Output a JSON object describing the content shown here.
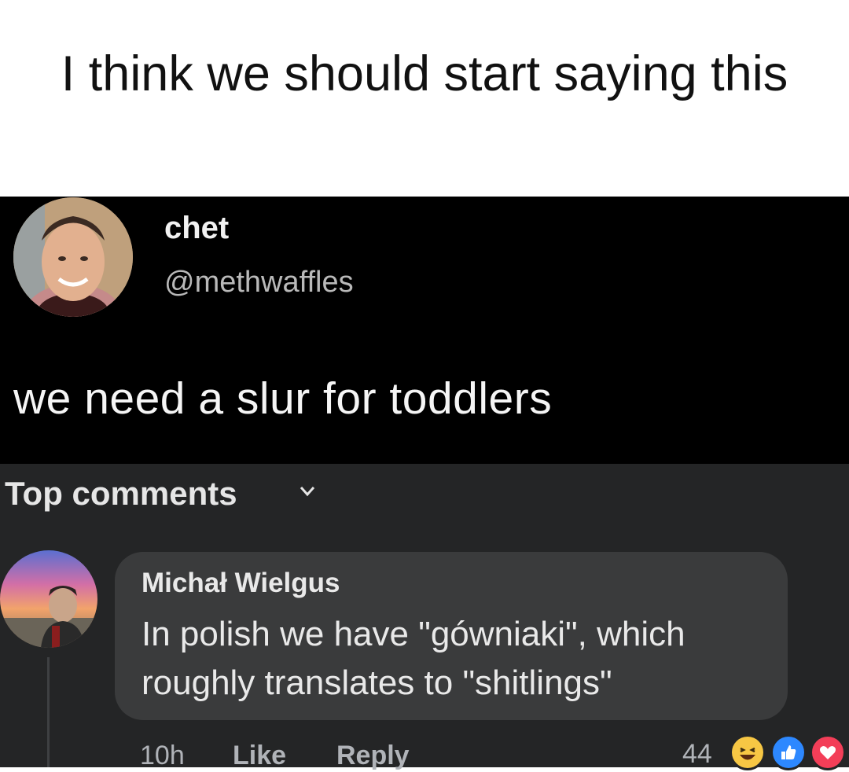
{
  "caption": {
    "text": "I think we should start saying this"
  },
  "tweet": {
    "author_name": "chet",
    "author_handle": "@methwaffles",
    "body": "we need a slur for toddlers"
  },
  "comments_section": {
    "sort_label": "Top comments",
    "comment": {
      "author": "Michał Wielgus",
      "text": "In polish we have \"gówniaki\", which roughly translates to \"shitlings\"",
      "time": "10h",
      "like_label": "Like",
      "reply_label": "Reply",
      "reaction_count": "44",
      "reactions": [
        "haha-icon",
        "like-icon",
        "love-icon"
      ]
    }
  },
  "colors": {
    "tweet_background": "#000000",
    "comments_background": "#242526",
    "bubble_background": "#3a3b3c",
    "like_blue": "#2d88ff",
    "love_red": "#f33e58",
    "haha_yellow": "#f7c744"
  }
}
